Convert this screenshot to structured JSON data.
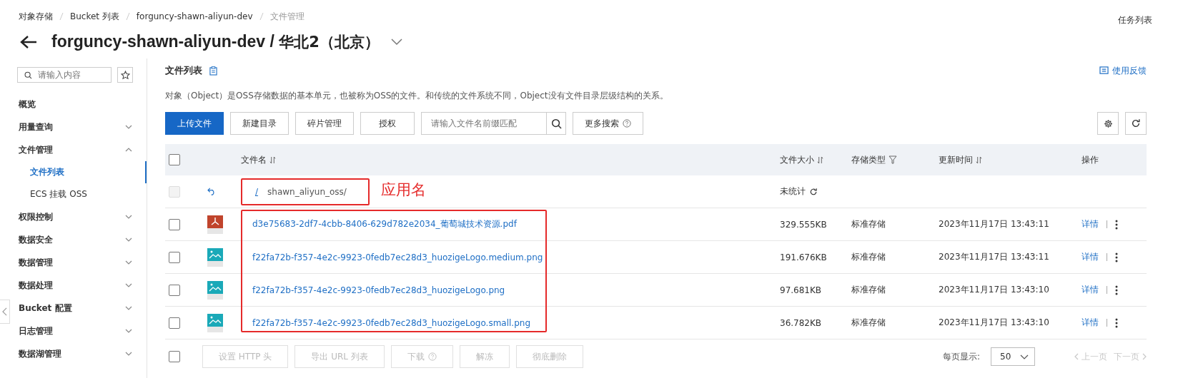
{
  "breadcrumb": [
    "对象存储",
    "Bucket 列表",
    "forguncy-shawn-aliyun-dev",
    "文件管理"
  ],
  "task_list": "任务列表",
  "header": {
    "title": "forguncy-shawn-aliyun-dev / ",
    "region": "华北2（北京）"
  },
  "sidebar": {
    "search": {
      "placeholder": "请输入内容"
    },
    "items": [
      {
        "label": "概览",
        "kind": "link",
        "selected": false
      },
      {
        "label": "用量查询",
        "kind": "group",
        "expanded": false,
        "selected": false
      },
      {
        "label": "文件管理",
        "kind": "group",
        "expanded": true,
        "selected": false,
        "children": [
          {
            "label": "文件列表",
            "selected": true
          },
          {
            "label": "ECS 挂载 OSS",
            "selected": false
          }
        ]
      },
      {
        "label": "权限控制",
        "kind": "group",
        "expanded": false,
        "selected": false
      },
      {
        "label": "数据安全",
        "kind": "group",
        "expanded": false,
        "selected": false
      },
      {
        "label": "数据管理",
        "kind": "group",
        "expanded": false,
        "selected": false
      },
      {
        "label": "数据处理",
        "kind": "group",
        "expanded": false,
        "selected": false
      },
      {
        "label": "Bucket 配置",
        "kind": "group",
        "expanded": false,
        "selected": false
      },
      {
        "label": "日志管理",
        "kind": "group",
        "expanded": false,
        "selected": false
      },
      {
        "label": "数据湖管理",
        "kind": "group",
        "expanded": false,
        "selected": false
      }
    ]
  },
  "main": {
    "title": "文件列表",
    "feedback": "使用反馈",
    "description": "对象（Object）是OSS存储数据的基本单元，也被称为OSS的文件。和传统的文件系统不同，Object没有文件目录层级结构的关系。",
    "toolbar": {
      "buttons": [
        {
          "label": "上传文件",
          "kind": "primary"
        },
        {
          "label": "新建目录",
          "kind": "default"
        },
        {
          "label": "碎片管理",
          "kind": "default"
        },
        {
          "label": "授权",
          "kind": "default"
        }
      ],
      "search": {
        "placeholder": "请输入文件名前缀匹配"
      },
      "more_search": "更多搜索"
    },
    "table": {
      "columns": [
        {
          "label": "文件名",
          "kind": "sort"
        },
        {
          "label": "文件大小",
          "kind": "sort"
        },
        {
          "label": "存储类型",
          "kind": "filter"
        },
        {
          "label": "更新时间",
          "kind": "sort"
        },
        {
          "label": "操作",
          "kind": "plain"
        }
      ],
      "header_checked": false,
      "rows": [
        {
          "kind": "folder",
          "root": "/",
          "name": "shawn_aliyun_oss/",
          "size": "未统计",
          "checked": false,
          "disabled": true
        },
        {
          "kind": "pdf",
          "name": "d3e75683-2df7-4cbb-8406-629d782e2034_葡萄城技术资源.pdf",
          "size": "329.555KB",
          "storage": "标准存储",
          "time": "2023年11月17日 13:43:11",
          "action": "详情",
          "checked": false,
          "disabled": false
        },
        {
          "kind": "image",
          "name": "f22fa72b-f357-4e2c-9923-0fedb7ec28d3_huozigeLogo.medium.png",
          "size": "191.676KB",
          "storage": "标准存储",
          "time": "2023年11月17日 13:43:11",
          "action": "详情",
          "checked": false,
          "disabled": false
        },
        {
          "kind": "image",
          "name": "f22fa72b-f357-4e2c-9923-0fedb7ec28d3_huozigeLogo.png",
          "size": "97.681KB",
          "storage": "标准存储",
          "time": "2023年11月17日 13:43:10",
          "action": "详情",
          "checked": false,
          "disabled": false
        },
        {
          "kind": "image",
          "name": "f22fa72b-f357-4e2c-9923-0fedb7ec28d3_huozigeLogo.small.png",
          "size": "36.782KB",
          "storage": "标准存储",
          "time": "2023年11月17日 13:43:10",
          "action": "详情",
          "checked": false,
          "disabled": false
        }
      ]
    },
    "annotation": {
      "label": "应用名"
    },
    "bulk": {
      "checked": false,
      "buttons": [
        {
          "label": "设置 HTTP 头",
          "help": false,
          "disabled": true
        },
        {
          "label": "导出 URL 列表",
          "help": false,
          "disabled": true
        },
        {
          "label": "下载",
          "help": true,
          "disabled": true
        },
        {
          "label": "解冻",
          "help": false,
          "disabled": true
        },
        {
          "label": "彻底删除",
          "help": false,
          "disabled": true
        }
      ]
    },
    "pagination": {
      "page_size_label": "每页显示:",
      "page_size": "50",
      "prev": "上一页",
      "next": "下一页",
      "disabled": true
    }
  }
}
